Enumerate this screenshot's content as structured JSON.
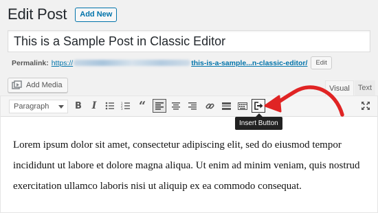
{
  "header": {
    "title": "Edit Post",
    "add_new_label": "Add New"
  },
  "post": {
    "title_value": "This is a Sample Post in Classic Editor"
  },
  "permalink": {
    "label": "Permalink:",
    "url_start": "https://",
    "slug": "this-is-a-sample...n-classic-editor/",
    "edit_label": "Edit"
  },
  "media": {
    "add_media_label": "Add Media"
  },
  "tabs": [
    {
      "label": "Visual",
      "active": true
    },
    {
      "label": "Text",
      "active": false
    }
  ],
  "toolbar": {
    "format_select": "Paragraph",
    "buttons": [
      "bold",
      "italic",
      "bulleted-list",
      "numbered-list",
      "blockquote",
      "align-left",
      "align-center",
      "align-right",
      "insert-link",
      "insert-read-more",
      "toolbar-toggle",
      "insert-button",
      "fullscreen"
    ],
    "tooltip": "Insert Button"
  },
  "content": {
    "paragraph": "Lorem ipsum dolor sit amet, consectetur adipiscing elit, sed do eiusmod tempor incididunt ut labore et dolore magna aliqua. Ut enim ad minim veniam, quis nostrud exercitation ullamco laboris nisi ut aliquip ex ea commodo consequat."
  },
  "colors": {
    "accent": "#0073aa",
    "arrow": "#e02424",
    "spellcheck": "#d54e21"
  }
}
